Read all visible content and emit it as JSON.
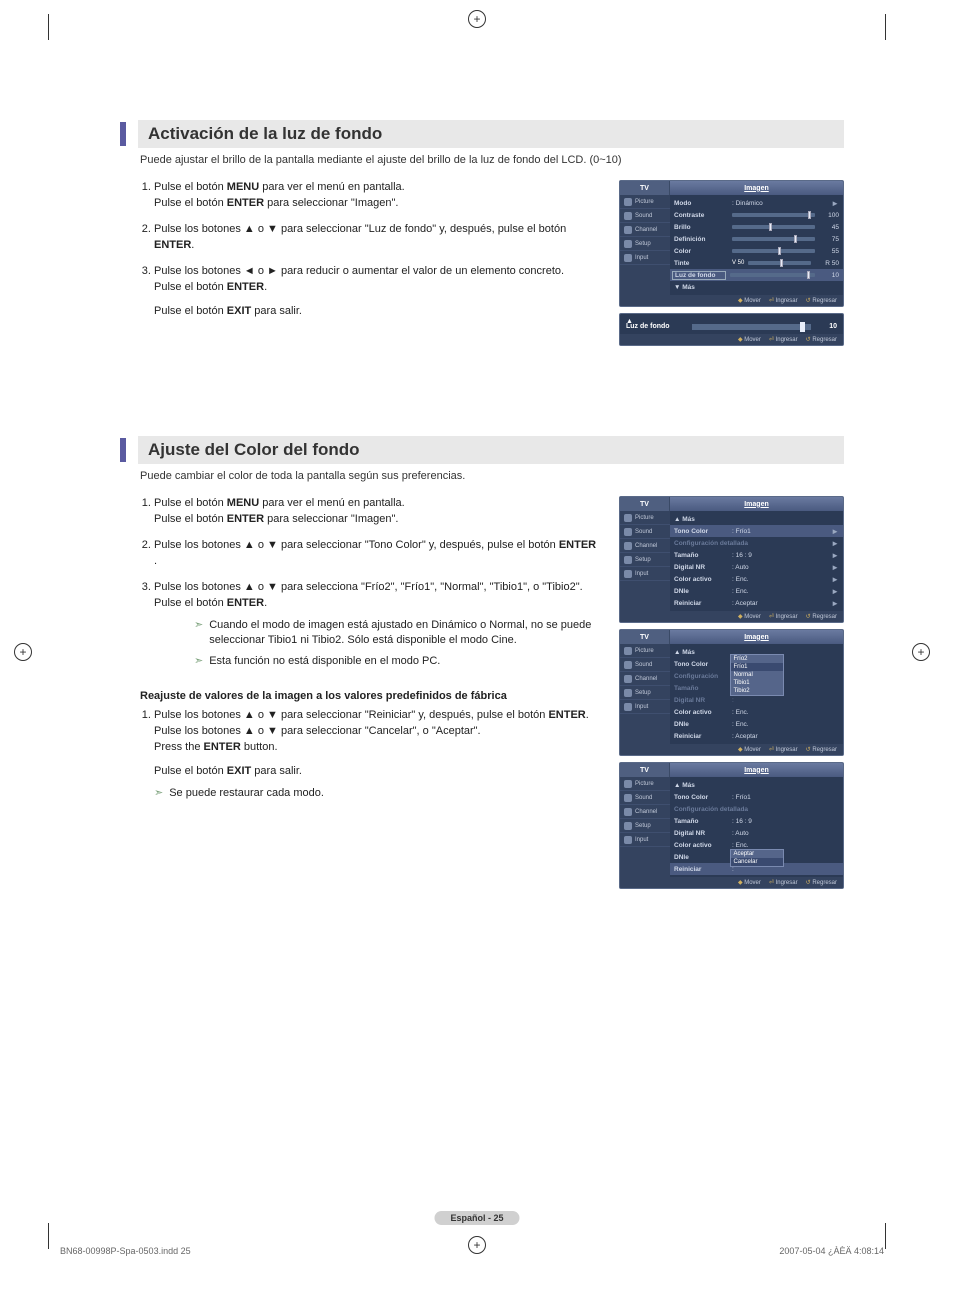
{
  "section1": {
    "heading": "Activación de la luz de fondo",
    "intro": "Puede ajustar el brillo de la pantalla mediante el ajuste del brillo de la luz de fondo del LCD. (0~10)",
    "steps": [
      {
        "pre": "Pulse el botón ",
        "b1": "MENU",
        "mid1": " para ver el menú en pantalla.\nPulse el botón ",
        "b2": "ENTER",
        "mid2": " para seleccionar \"Imagen\"."
      },
      {
        "pre": "Pulse los botones ▲ o ▼ para seleccionar \"Luz de fondo\" y, después, pulse el botón ",
        "b1": "ENTER",
        "post": "."
      },
      {
        "lines": [
          "Pulse los botones ◄ o ► para reducir o aumentar el valor de un elemento concreto.",
          "Pulse el botón ENTER.",
          "Pulse el botón EXIT para salir."
        ]
      }
    ]
  },
  "section2": {
    "heading": "Ajuste del Color del fondo",
    "intro": "Puede cambiar el color de toda la pantalla según sus preferencias.",
    "steps": [
      {
        "pre": "Pulse el botón ",
        "b1": "MENU",
        "mid1": " para ver el menú en pantalla.\nPulse el botón ",
        "b2": "ENTER",
        "mid2": " para seleccionar \"Imagen\"."
      },
      {
        "pre": "Pulse los botones ▲ o ▼ para seleccionar \"Tono Color\" y, después, pulse el botón ",
        "b1": "ENTER",
        "post": " ."
      },
      {
        "pre": "Pulse los botones ▲ o ▼ para selecciona \"Frío2\", \"Frío1\", \"Normal\", \"Tibio1\", o \"Tibio2\". Pulse el botón ",
        "b1": "ENTER",
        "post": "."
      }
    ],
    "notes": [
      "Cuando el modo de imagen está ajustado en Dinámico o Normal, no se puede seleccionar Tibio1 ni Tibio2. Sólo está disponible el modo Cine.",
      "Esta función no está disponible en el modo PC."
    ],
    "factory": {
      "title": "Reajuste de valores de la imagen a los valores predefinidos de fábrica",
      "step": [
        "Pulse los botones ▲ o ▼ para seleccionar \"Reiniciar\" y, después, pulse el botón ENTER.",
        "Pulse los botones ▲ o ▼ para seleccionar \"Cancelar\", o \"Aceptar\".",
        "Press the ENTER button.",
        "Pulse el botón EXIT para salir."
      ],
      "note": "Se puede restaurar cada modo."
    }
  },
  "osd": {
    "tv": "TV",
    "cat": "Imagen",
    "side": [
      "Picture",
      "Sound",
      "Channel",
      "Setup",
      "Input"
    ],
    "foot_move": "Mover",
    "foot_enter": "Ingresar",
    "foot_return": "Regresar",
    "panel1": {
      "rows": [
        {
          "lab": "Modo",
          "val": ": Dinámico",
          "arrow": true
        },
        {
          "lab": "Contraste",
          "slider": 95,
          "num": "100"
        },
        {
          "lab": "Brillo",
          "slider": 45,
          "num": "45"
        },
        {
          "lab": "Definición",
          "slider": 75,
          "num": "75"
        },
        {
          "lab": "Color",
          "slider": 55,
          "num": "55"
        },
        {
          "lab": "Tinte",
          "pre": "V 50",
          "slider": 50,
          "num": "R 50"
        },
        {
          "lab": "Luz de fondo",
          "slider": 90,
          "num": "10",
          "hl": true
        },
        {
          "lab": "▼ Más"
        }
      ]
    },
    "backlight": {
      "label": "Luz de fondo",
      "value": "10",
      "up": "▲"
    },
    "panel2a": {
      "rows": [
        {
          "lab": "▲ Más"
        },
        {
          "lab": "Tono Color",
          "val": ": Frío1",
          "arrow": true,
          "hl": true
        },
        {
          "lab": "Configuración detallada",
          "dim": true,
          "arrow": true
        },
        {
          "lab": "Tamaño",
          "val": ": 16 : 9",
          "arrow": true
        },
        {
          "lab": "Digital NR",
          "val": ": Auto",
          "arrow": true
        },
        {
          "lab": "Color activo",
          "val": ": Enc.",
          "arrow": true
        },
        {
          "lab": "DNIe",
          "val": ": Enc.",
          "arrow": true
        },
        {
          "lab": "Reiniciar",
          "val": ": Aceptar",
          "arrow": true
        }
      ]
    },
    "panel2b": {
      "rows": [
        {
          "lab": "▲ Más"
        },
        {
          "lab": "Tono Color",
          "val": ":",
          "dropdown": [
            "Frío2",
            "Frío1",
            "Normal",
            "Tibio1",
            "Tibio2"
          ],
          "sel": "Frío1"
        },
        {
          "lab": "Configuración",
          "dim": true
        },
        {
          "lab": "Tamaño",
          "val": ":",
          "dim": true
        },
        {
          "lab": "Digital NR",
          "val": ":",
          "dim": true
        },
        {
          "lab": "Color activo",
          "val": ": Enc."
        },
        {
          "lab": "DNIe",
          "val": ": Enc."
        },
        {
          "lab": "Reiniciar",
          "val": ": Aceptar"
        }
      ]
    },
    "panel2c": {
      "rows": [
        {
          "lab": "▲ Más"
        },
        {
          "lab": "Tono Color",
          "val": ": Frío1"
        },
        {
          "lab": "Configuración detallada",
          "dim": true
        },
        {
          "lab": "Tamaño",
          "val": ": 16 : 9"
        },
        {
          "lab": "Digital NR",
          "val": ": Auto"
        },
        {
          "lab": "Color activo",
          "val": ": Enc."
        },
        {
          "lab": "DNIe",
          "val": ":",
          "dropdown2": [
            "Aceptar",
            "Cancelar"
          ],
          "sel": "Cancelar"
        },
        {
          "lab": "Reiniciar",
          "val": ":",
          "hl": true
        }
      ]
    }
  },
  "footer": {
    "page": "Español - 25"
  },
  "print": {
    "file": "BN68-00998P-Spa-0503.indd   25",
    "stamp": "2007-05-04   ¿ÀÈÄ 4:08:14"
  }
}
